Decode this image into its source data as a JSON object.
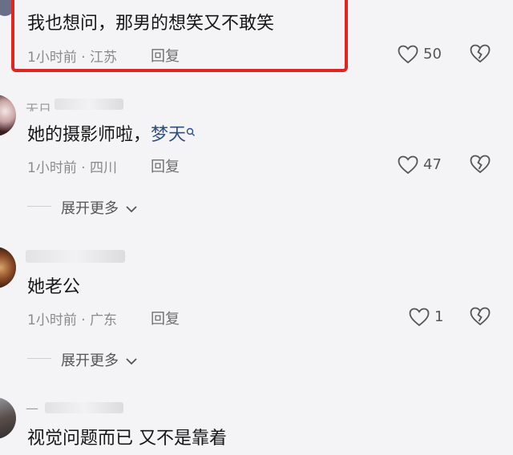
{
  "comments": [
    {
      "text": "我也想问，那男的想笑又不敢笑",
      "time": "1小时前",
      "location": "江苏",
      "reply": "回复",
      "likes": "50"
    },
    {
      "name_partial": "无日",
      "text": "她的摄影师啦，",
      "mention": "梦天",
      "time": "1小时前",
      "location": "四川",
      "reply": "回复",
      "likes": "47",
      "expand": "展开更多"
    },
    {
      "text": "她老公",
      "time": "1小时前",
      "location": "广东",
      "reply": "回复",
      "likes": "1",
      "expand": "展开更多"
    },
    {
      "name_partial": "—",
      "text": "视觉问题而已 又不是靠着"
    }
  ],
  "meta_separator": "·",
  "colors": {
    "highlight": "#e02424",
    "mention": "#2c4f86",
    "background": "#f4f4f6"
  },
  "icons": [
    "heart-outline-icon",
    "broken-heart-icon",
    "search-mini-icon",
    "chevron-down-icon"
  ]
}
